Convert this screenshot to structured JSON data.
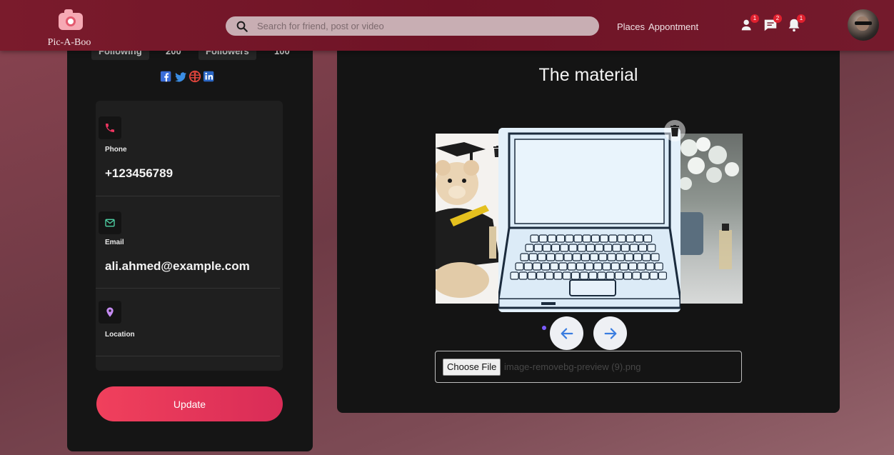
{
  "app": {
    "logo_text": "Pic-A-Boo"
  },
  "search": {
    "placeholder": "Search for friend, post or video"
  },
  "nav": {
    "links": [
      "Places",
      "Appontment"
    ],
    "badges": {
      "friends": "1",
      "messages": "2",
      "notifications": "1"
    }
  },
  "profile": {
    "following_label": "Following",
    "following_count": "200",
    "followers_label": "Followers",
    "followers_count": "100",
    "socials": [
      "facebook-icon",
      "twitter-icon",
      "dribbble-icon",
      "linkedin-icon"
    ]
  },
  "contact": {
    "phone_label": "Phone",
    "phone_value": "+123456789",
    "email_label": "Email",
    "email_value": "ali.ahmed@example.com",
    "location_label": "Location",
    "location_value": ""
  },
  "actions": {
    "update_label": "Update"
  },
  "material": {
    "title": "The material",
    "choose_file_label": "Choose File",
    "file_name": "image-removebg-preview (9).png"
  },
  "colors": {
    "topbar": "#741a2c",
    "accent": "#f0405c",
    "panel": "#151515",
    "badge": "#e0202e"
  }
}
